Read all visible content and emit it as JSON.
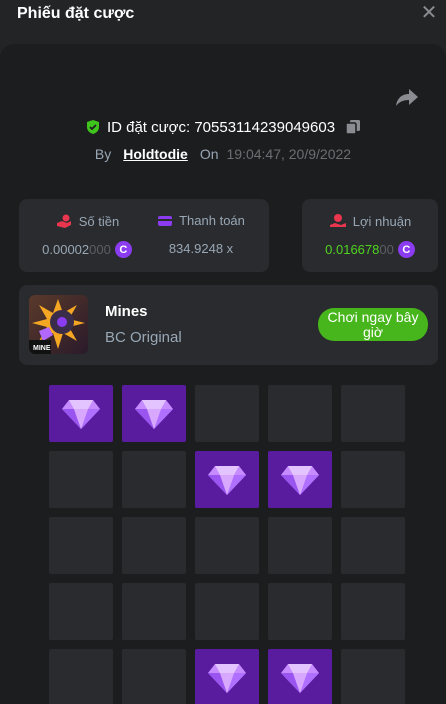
{
  "header": {
    "title": "Phiếu đặt cược"
  },
  "bet": {
    "id_text": "ID đặt cược: 70553114239049603",
    "by_label": "By",
    "username": "Holdtodie",
    "on_label": "On",
    "timestamp": "19:04:47, 20/9/2022"
  },
  "stats": {
    "amount": {
      "label": "Số tiền",
      "value_main": "0.00002",
      "value_dim": "000",
      "coin": "C"
    },
    "payout": {
      "label": "Thanh toán",
      "value": "834.9248 x"
    },
    "profit": {
      "label": "Lợi nhuận",
      "value_main": "0.016678",
      "value_dim": "00",
      "coin": "C"
    }
  },
  "game": {
    "name": "Mines",
    "provider": "BC Original",
    "thumb_text": "MINE",
    "play_label": "Chơi ngay bây giờ"
  },
  "grid": {
    "rows": 5,
    "cols": 5,
    "cells": [
      "gem",
      "gem",
      "empty",
      "empty",
      "empty",
      "empty",
      "empty",
      "gem",
      "gem",
      "empty",
      "empty",
      "empty",
      "empty",
      "empty",
      "empty",
      "empty",
      "empty",
      "empty",
      "empty",
      "empty",
      "empty",
      "empty",
      "gem",
      "gem",
      "empty"
    ]
  },
  "colors": {
    "accent_purple": "#5a1c9e",
    "play_green": "#47b51c",
    "profit_green": "#4fd41f"
  }
}
